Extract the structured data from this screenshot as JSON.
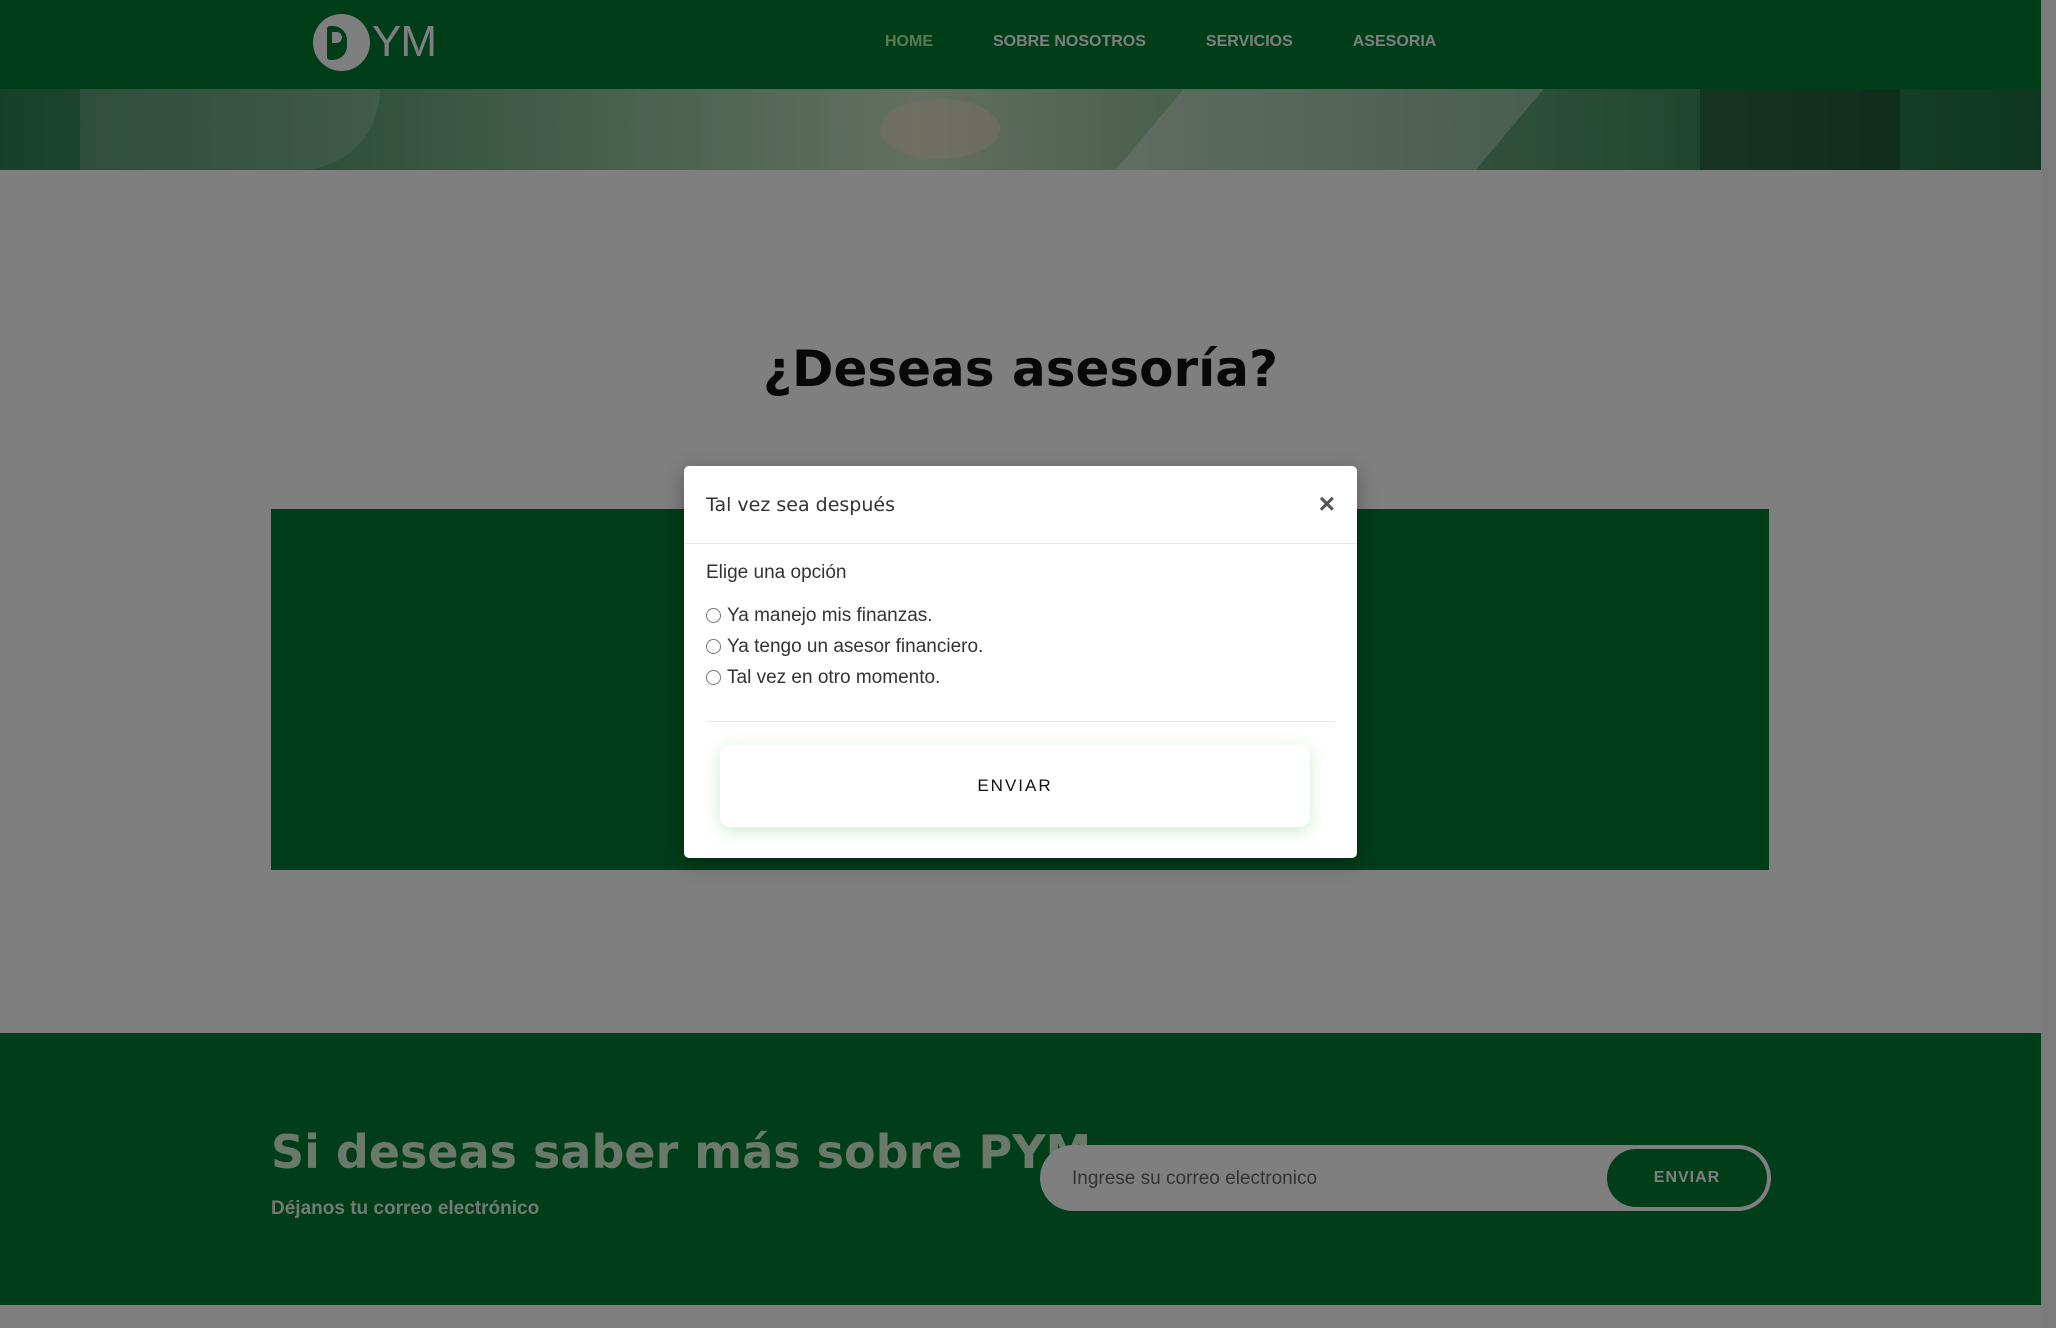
{
  "navbar": {
    "logo_text": "YM",
    "items": [
      {
        "label": "HOME",
        "active": true
      },
      {
        "label": "SOBRE NOSOTROS",
        "active": false
      },
      {
        "label": "SERVICIOS",
        "active": false
      },
      {
        "label": "ASESORIA",
        "active": false
      }
    ]
  },
  "main": {
    "title": "¿Deseas asesoría?"
  },
  "modal": {
    "title": "Tal vez sea después",
    "close_glyph": "×",
    "prompt": "Elige una opción",
    "options": [
      "Ya manejo mis finanzas.",
      "Ya tengo un asesor financiero.",
      "Tal vez en otro momento."
    ],
    "submit_label": "ENVIAR"
  },
  "footer": {
    "title": "Si deseas saber más sobre PYM",
    "subtitle": "Déjanos tu correo electrónico",
    "email_placeholder": "Ingrese su correo electronico",
    "submit_label": "ENVIAR"
  },
  "colors": {
    "brand_green": "#007a33",
    "active_nav": "#b6f5a8",
    "overlay": "rgba(0,0,0,0.5)"
  },
  "icons": {
    "close": "close-icon",
    "logo": "pym-logo-icon"
  }
}
